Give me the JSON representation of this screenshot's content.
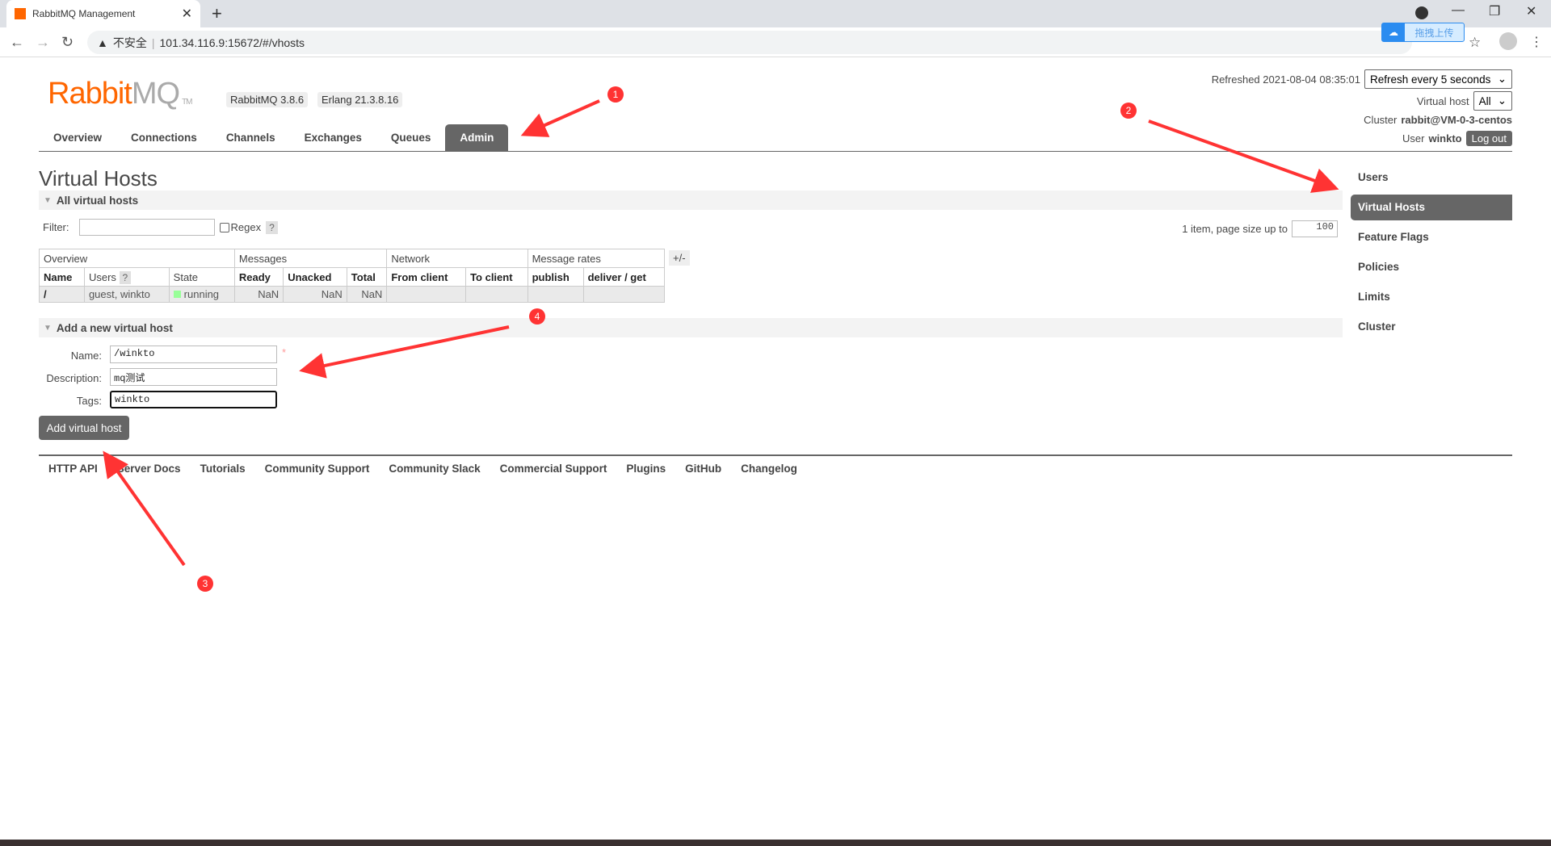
{
  "browser": {
    "tab_title": "RabbitMQ Management",
    "security": "不安全",
    "url": "101.34.116.9:15672/#/vhosts",
    "baidu_label": "拖拽上传"
  },
  "header": {
    "logo_rabbit": "Rabbit",
    "logo_mq": "MQ",
    "logo_tm": "TM",
    "version": "RabbitMQ 3.8.6",
    "erlang": "Erlang 21.3.8.16",
    "refreshed": "Refreshed 2021-08-04 08:35:01",
    "refresh_select": "Refresh every 5 seconds",
    "vhost_label": "Virtual host",
    "vhost_select": "All",
    "cluster_label": "Cluster",
    "cluster_name": "rabbit@VM-0-3-centos",
    "user_label": "User",
    "user_name": "winkto",
    "logout": "Log out"
  },
  "nav": [
    "Overview",
    "Connections",
    "Channels",
    "Exchanges",
    "Queues",
    "Admin"
  ],
  "nav_active": "Admin",
  "page_title": "Virtual Hosts",
  "all_vhosts": {
    "section": "All virtual hosts",
    "filter_label": "Filter:",
    "filter_value": "",
    "regex_label": "Regex",
    "help": "?",
    "pagination": "1 item, page size up to",
    "page_size": "100",
    "group_headers": [
      "Overview",
      "Messages",
      "Network",
      "Message rates"
    ],
    "plus_minus": "+/-",
    "columns": [
      "Name",
      "Users",
      "State",
      "Ready",
      "Unacked",
      "Total",
      "From client",
      "To client",
      "publish",
      "deliver / get"
    ],
    "rows": [
      {
        "name": "/",
        "users": "guest, winkto",
        "state": "running",
        "ready": "NaN",
        "unacked": "NaN",
        "total": "NaN",
        "from_client": "",
        "to_client": "",
        "publish": "",
        "deliver_get": ""
      }
    ]
  },
  "add_vhost": {
    "section": "Add a new virtual host",
    "name_label": "Name:",
    "name_value": "/winkto",
    "required": "*",
    "desc_label": "Description:",
    "desc_value": "mq测试",
    "tags_label": "Tags:",
    "tags_value": "winkto",
    "button": "Add virtual host"
  },
  "footer": [
    "HTTP API",
    "Server Docs",
    "Tutorials",
    "Community Support",
    "Community Slack",
    "Commercial Support",
    "Plugins",
    "GitHub",
    "Changelog"
  ],
  "sidebar": [
    "Users",
    "Virtual Hosts",
    "Feature Flags",
    "Policies",
    "Limits",
    "Cluster"
  ],
  "sidebar_active": "Virtual Hosts",
  "annotations": [
    "1",
    "2",
    "3",
    "4"
  ],
  "colors": {
    "accent": "#ff6600",
    "nav_active": "#666666",
    "annotation": "#ff3333",
    "running": "#99ff99"
  }
}
